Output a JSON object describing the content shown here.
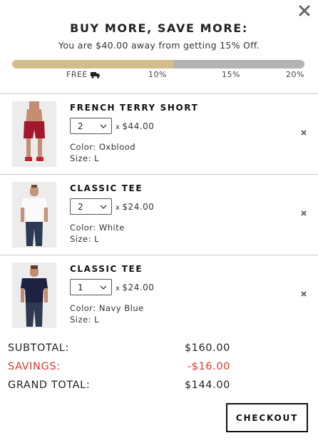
{
  "promo": {
    "title": "BUY MORE, SAVE MORE:",
    "subtitle": "You are $40.00 away from getting 15% Off.",
    "progress_fraction": 0.55
  },
  "progress_labels": {
    "free": "FREE",
    "ten": "10%",
    "fifteen": "15%",
    "twenty": "20%"
  },
  "cart": {
    "items": [
      {
        "name": "FRENCH TERRY SHORT",
        "quantity": "2",
        "price": "$44.00",
        "color": "Color: Oxblood",
        "size": "Size: L",
        "image": "shorts-photo",
        "accent": "#a3192b"
      },
      {
        "name": "CLASSIC TEE",
        "quantity": "2",
        "price": "$24.00",
        "color": "Color: White",
        "size": "Size: L",
        "image": "white-tee-photo",
        "accent": "#f4f4f4"
      },
      {
        "name": "CLASSIC TEE",
        "quantity": "1",
        "price": "$24.00",
        "color": "Color: Navy Blue",
        "size": "Size: L",
        "image": "navy-tee-photo",
        "accent": "#1d2142"
      }
    ],
    "times_symbol": "x"
  },
  "totals": {
    "subtotal_label": "SUBTOTAL:",
    "subtotal_value": "$160.00",
    "savings_label": "SAVINGS:",
    "savings_value": "-$16.00",
    "grand_label": "GRAND TOTAL:",
    "grand_value": "$144.00"
  },
  "checkout_label": "CHECKOUT",
  "colors": {
    "progress_fill": "#d4bc8c",
    "progress_track": "#b3b3b3",
    "savings": "#e0342a"
  },
  "icons": {
    "close": "close-icon",
    "truck": "truck-icon",
    "remove": "remove-icon",
    "chevron": "chevron-down-icon"
  }
}
